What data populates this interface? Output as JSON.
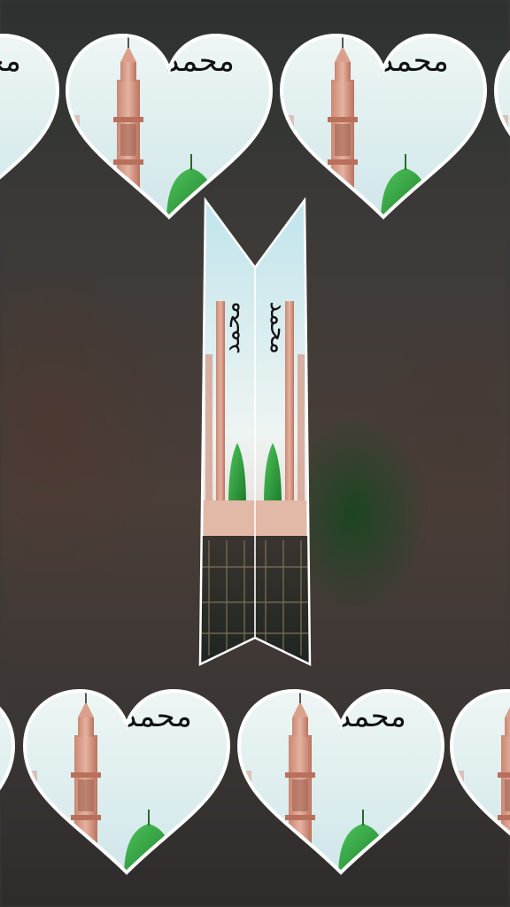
{
  "calligraphy_text": "محمد",
  "colors": {
    "sky": "#e4f0f0",
    "minaret": "#d69a84",
    "dome": "#2e9a3a",
    "outline": "#ffffff"
  },
  "hearts": [
    {
      "name": "heart-top-left-partial"
    },
    {
      "name": "heart-top-1"
    },
    {
      "name": "heart-top-2"
    },
    {
      "name": "heart-top-right-partial"
    },
    {
      "name": "heart-bottom-left-partial"
    },
    {
      "name": "heart-bottom-1"
    },
    {
      "name": "heart-bottom-2"
    },
    {
      "name": "heart-bottom-right-partial"
    }
  ]
}
